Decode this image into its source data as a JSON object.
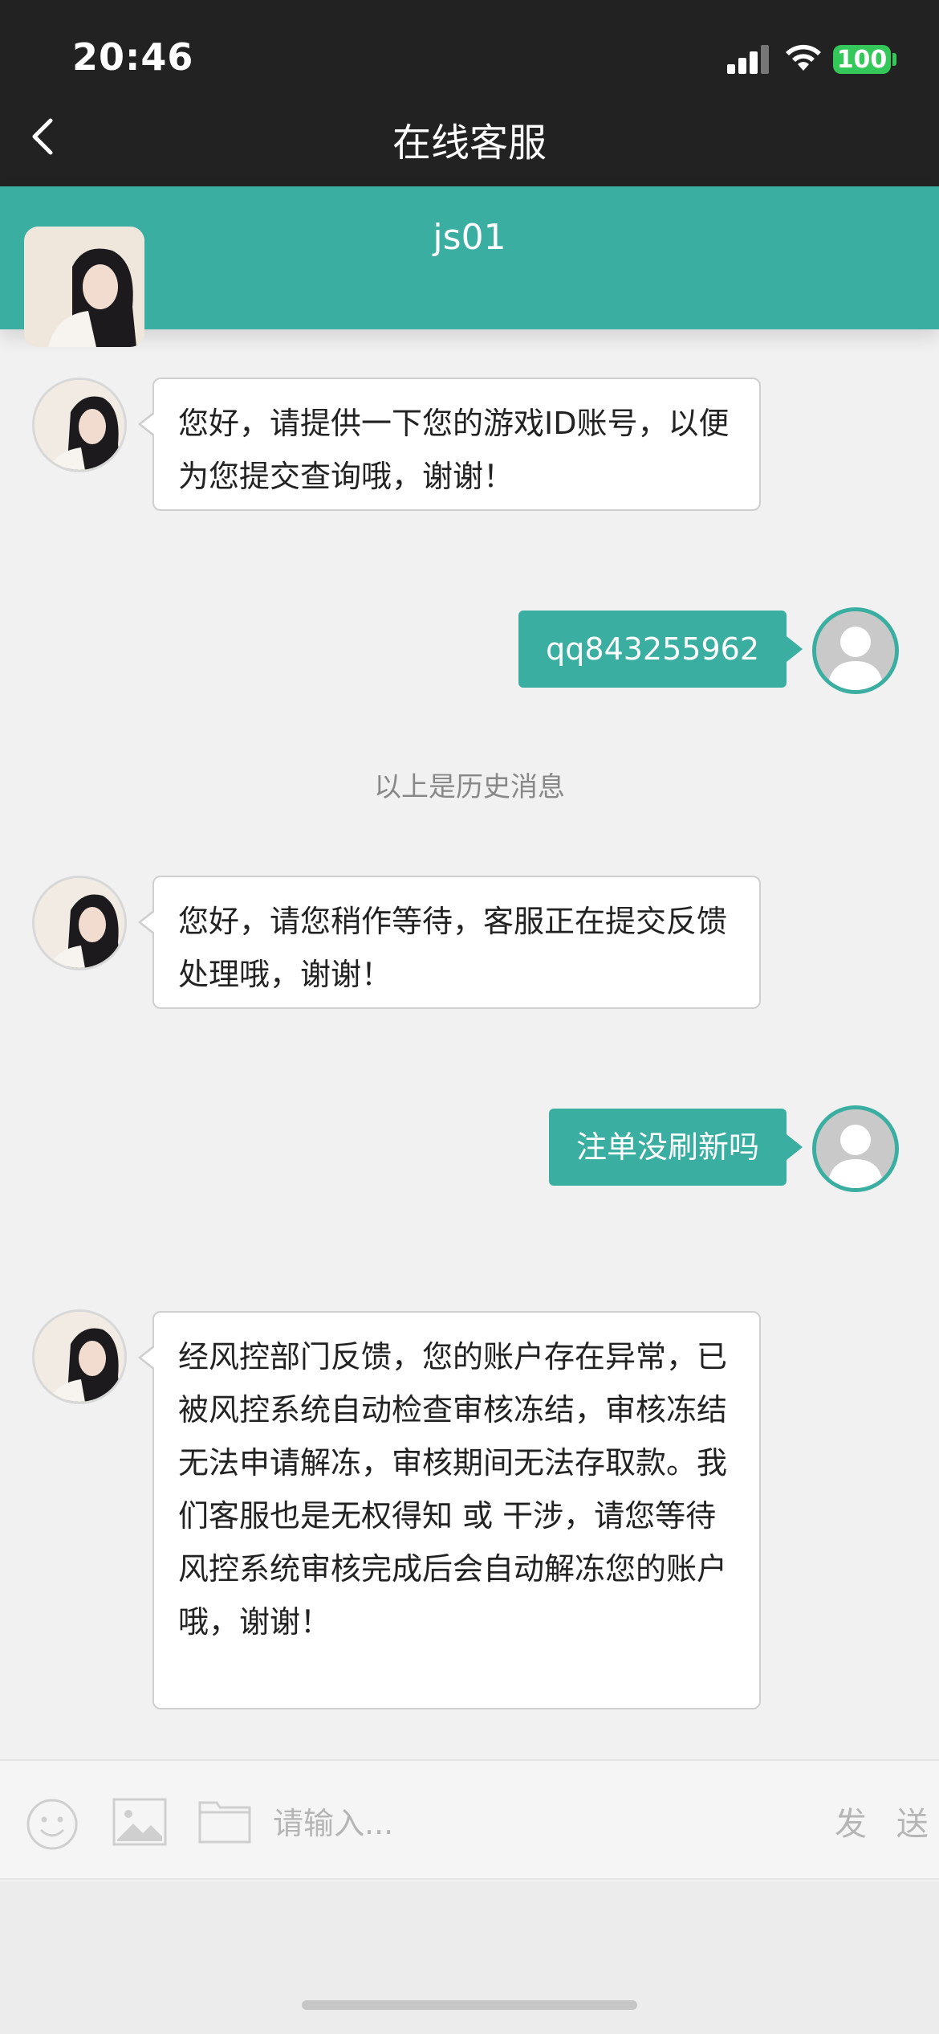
{
  "status_bar": {
    "time": "20:46",
    "battery": "100"
  },
  "nav": {
    "title": "在线客服"
  },
  "agent": {
    "name": "js01"
  },
  "messages": [
    {
      "from": "agent",
      "text": "您好，请提供一下您的游戏ID账号，以便为您提交查询哦，谢谢！"
    },
    {
      "from": "user",
      "text": "qq843255962"
    },
    {
      "from": "agent",
      "text": "您好，请您稍作等待，客服正在提交反馈处理哦，谢谢！"
    },
    {
      "from": "user",
      "text": "注单没刷新吗"
    },
    {
      "from": "agent",
      "text": "经风控部门反馈，您的账户存在异常，已被风控系统自动检查审核冻结，审核冻结无法申请解冻，审核期间无法存取款。我们客服也是无权得知 或 干涉，请您等待风控系统审核完成后会自动解冻您的账户哦，谢谢！"
    }
  ],
  "history_note": "以上是历史消息",
  "input_bar": {
    "placeholder": "请输入...",
    "send_label": "发 送"
  },
  "colors": {
    "accent": "#3aafa1",
    "topbar": "#222222",
    "battery": "#34c759"
  }
}
